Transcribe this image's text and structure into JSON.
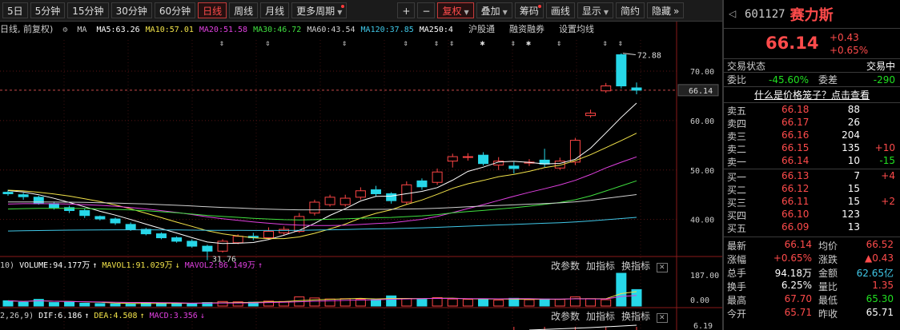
{
  "toolbar": {
    "periods": [
      {
        "label": "5日"
      },
      {
        "label": "5分钟"
      },
      {
        "label": "15分钟"
      },
      {
        "label": "30分钟"
      },
      {
        "label": "60分钟"
      },
      {
        "label": "日线",
        "active": true
      },
      {
        "label": "周线"
      },
      {
        "label": "月线"
      },
      {
        "label": "更多周期",
        "caret": true,
        "dot": true
      }
    ],
    "plus": "+",
    "minus": "−",
    "tools": [
      {
        "label": "复权",
        "active": true,
        "caret": true
      },
      {
        "label": "叠加",
        "caret": true
      },
      {
        "label": "筹码",
        "dot": true
      },
      {
        "label": "画线"
      },
      {
        "label": "显示",
        "caret": true
      },
      {
        "label": "简约"
      },
      {
        "label": "隐藏",
        "more": "»"
      }
    ]
  },
  "ma_line": {
    "prefix": "日线, 前复权)",
    "ma_label": "MA",
    "items": [
      {
        "text": "MA5:63.26",
        "color": "#ffffff"
      },
      {
        "text": "MA10:57.01",
        "color": "#f2e34a"
      },
      {
        "text": "MA20:51.58",
        "color": "#e040e0"
      },
      {
        "text": "MA30:46.72",
        "color": "#40e040"
      },
      {
        "text": "MA60:43.54",
        "color": "#cfcfcf"
      },
      {
        "text": "MA120:37.85",
        "color": "#40c8e8"
      },
      {
        "text": "MA250:4",
        "color": "#ffffff"
      }
    ],
    "links": [
      "沪股通",
      "融资融券",
      "设置均线"
    ]
  },
  "price_axis": {
    "ticks": [
      "70.00",
      "60.00",
      "50.00",
      "40.00"
    ],
    "current": "66.14"
  },
  "annotations": {
    "high": "72.88",
    "low": "31.76"
  },
  "event_markers": [
    "⇕",
    "⇕",
    "⇕",
    "⇕",
    "⇕",
    "⇕",
    "✱",
    "⇕",
    "✱",
    "⇕",
    "⇕",
    "⇕"
  ],
  "volume": {
    "prefix": "10)",
    "items": [
      {
        "text": "VOLUME:94.177万",
        "color": "#ffffff"
      },
      {
        "text": "MAVOL1:91.029万",
        "color": "#f2e34a"
      },
      {
        "text": "MAVOL2:86.149万",
        "color": "#e040e0"
      }
    ],
    "buttons": [
      "改参数",
      "加指标",
      "换指标"
    ],
    "axis": [
      "187.00",
      "0.00"
    ]
  },
  "macd": {
    "prefix": "2,26,9)",
    "items": [
      {
        "text": "DIF:6.186",
        "color": "#ffffff"
      },
      {
        "text": "DEA:4.508",
        "color": "#f2e34a"
      },
      {
        "text": "MACD:3.356",
        "color": "#e040e0"
      }
    ],
    "buttons": [
      "改参数",
      "加指标",
      "换指标"
    ],
    "axis": [
      "6.19"
    ]
  },
  "chart_data": {
    "type": "candlestick",
    "price_range": [
      33,
      75
    ],
    "candles": [
      {
        "o": 45.5,
        "c": 45.2,
        "h": 46.0,
        "l": 44.8
      },
      {
        "o": 45.0,
        "c": 44.6,
        "h": 45.4,
        "l": 44.0
      },
      {
        "o": 44.5,
        "c": 43.2,
        "h": 44.8,
        "l": 43.0
      },
      {
        "o": 43.2,
        "c": 42.4,
        "h": 43.6,
        "l": 42.0
      },
      {
        "o": 42.4,
        "c": 41.8,
        "h": 42.8,
        "l": 41.3
      },
      {
        "o": 41.8,
        "c": 40.8,
        "h": 42.2,
        "l": 40.3
      },
      {
        "o": 40.6,
        "c": 40.1,
        "h": 40.8,
        "l": 39.8
      },
      {
        "o": 40.1,
        "c": 39.3,
        "h": 40.4,
        "l": 38.9
      },
      {
        "o": 39.0,
        "c": 38.0,
        "h": 39.4,
        "l": 37.7
      },
      {
        "o": 38.0,
        "c": 37.1,
        "h": 38.3,
        "l": 36.8
      },
      {
        "o": 37.1,
        "c": 36.3,
        "h": 37.4,
        "l": 36.0
      },
      {
        "o": 36.3,
        "c": 35.6,
        "h": 36.6,
        "l": 35.3
      },
      {
        "o": 35.6,
        "c": 34.6,
        "h": 36.0,
        "l": 34.3
      },
      {
        "o": 34.6,
        "c": 33.6,
        "h": 34.9,
        "l": 31.76
      },
      {
        "o": 33.6,
        "c": 35.6,
        "h": 36.0,
        "l": 33.3
      },
      {
        "o": 35.3,
        "c": 36.6,
        "h": 37.0,
        "l": 35.0
      },
      {
        "o": 36.6,
        "c": 36.3,
        "h": 37.3,
        "l": 35.8
      },
      {
        "o": 36.3,
        "c": 37.6,
        "h": 38.4,
        "l": 35.9
      },
      {
        "o": 37.3,
        "c": 38.0,
        "h": 38.6,
        "l": 36.9
      },
      {
        "o": 37.6,
        "c": 40.6,
        "h": 41.3,
        "l": 37.3
      },
      {
        "o": 41.3,
        "c": 43.5,
        "h": 44.0,
        "l": 40.8
      },
      {
        "o": 43.0,
        "c": 44.5,
        "h": 45.0,
        "l": 42.6
      },
      {
        "o": 43.0,
        "c": 44.3,
        "h": 45.0,
        "l": 42.6
      },
      {
        "o": 44.5,
        "c": 45.8,
        "h": 46.5,
        "l": 44.0
      },
      {
        "o": 46.0,
        "c": 45.2,
        "h": 46.8,
        "l": 44.6
      },
      {
        "o": 45.2,
        "c": 43.8,
        "h": 45.5,
        "l": 43.2
      },
      {
        "o": 43.5,
        "c": 47.0,
        "h": 47.7,
        "l": 43.0
      },
      {
        "o": 47.8,
        "c": 46.6,
        "h": 48.3,
        "l": 46.0
      },
      {
        "o": 47.5,
        "c": 49.6,
        "h": 50.3,
        "l": 47.0
      },
      {
        "o": 51.8,
        "c": 52.7,
        "h": 53.3,
        "l": 50.5
      },
      {
        "o": 52.7,
        "c": 52.7,
        "h": 53.4,
        "l": 51.9
      },
      {
        "o": 53.0,
        "c": 51.3,
        "h": 53.6,
        "l": 50.9
      },
      {
        "o": 51.0,
        "c": 51.8,
        "h": 52.6,
        "l": 50.0
      },
      {
        "o": 50.8,
        "c": 50.3,
        "h": 51.6,
        "l": 49.3
      },
      {
        "o": 51.4,
        "c": 51.6,
        "h": 52.2,
        "l": 50.8
      },
      {
        "o": 52.0,
        "c": 51.2,
        "h": 54.3,
        "l": 50.6
      },
      {
        "o": 50.4,
        "c": 51.8,
        "h": 52.5,
        "l": 50.0
      },
      {
        "o": 51.6,
        "c": 56.0,
        "h": 56.5,
        "l": 51.0
      },
      {
        "o": 61.0,
        "c": 61.5,
        "h": 62.2,
        "l": 60.6
      },
      {
        "o": 66.0,
        "c": 67.0,
        "h": 67.6,
        "l": 65.6
      },
      {
        "o": 73.3,
        "c": 67.0,
        "h": 73.6,
        "l": 66.5
      },
      {
        "o": 66.6,
        "c": 66.14,
        "h": 67.7,
        "l": 65.3
      }
    ],
    "volumes": [
      30,
      22,
      38,
      20,
      22,
      16,
      14,
      12,
      11,
      20,
      18,
      16,
      14,
      20,
      26,
      24,
      22,
      28,
      26,
      52,
      46,
      40,
      42,
      38,
      36,
      58,
      42,
      38,
      48,
      40,
      38,
      40,
      34,
      44,
      36,
      40,
      38,
      52,
      42,
      36,
      187,
      94
    ]
  },
  "side": {
    "code": "601127",
    "name": "赛力斯",
    "price": "66.14",
    "change": "+0.43",
    "change_pct": "+0.65%",
    "status_label": "交易状态",
    "status_value": "交易中",
    "weibi_label": "委比",
    "weibi": "-45.60%",
    "weicha_label": "委差",
    "weicha": "-290",
    "link": "什么是价格笼子？点击查看",
    "asks": [
      {
        "label": "卖五",
        "price": "66.18",
        "vol": "88",
        "delta": ""
      },
      {
        "label": "卖四",
        "price": "66.17",
        "vol": "26",
        "delta": ""
      },
      {
        "label": "卖三",
        "price": "66.16",
        "vol": "204",
        "delta": ""
      },
      {
        "label": "卖二",
        "price": "66.15",
        "vol": "135",
        "delta": "+10",
        "dcolor": "#ff4b4b"
      },
      {
        "label": "卖一",
        "price": "66.14",
        "vol": "10",
        "delta": "-15",
        "dcolor": "#21e021"
      }
    ],
    "bids": [
      {
        "label": "买一",
        "price": "66.13",
        "vol": "7",
        "delta": "+4",
        "dcolor": "#ff4b4b"
      },
      {
        "label": "买二",
        "price": "66.12",
        "vol": "15",
        "delta": ""
      },
      {
        "label": "买三",
        "price": "66.11",
        "vol": "15",
        "delta": "+2",
        "dcolor": "#ff4b4b"
      },
      {
        "label": "买四",
        "price": "66.10",
        "vol": "123",
        "delta": ""
      },
      {
        "label": "买五",
        "price": "66.09",
        "vol": "13",
        "delta": ""
      }
    ],
    "stats": [
      {
        "l1": "最新",
        "v1": "66.14",
        "c1": "#ff4b4b",
        "l2": "均价",
        "v2": "66.52",
        "c2": "#ff4b4b"
      },
      {
        "l1": "涨幅",
        "v1": "+0.65%",
        "c1": "#ff4b4b",
        "l2": "涨跌",
        "v2": "▲0.43",
        "c2": "#ff4b4b"
      },
      {
        "l1": "总手",
        "v1": "94.18万",
        "c1": "#ffffff",
        "l2": "金额",
        "v2": "62.65亿",
        "c2": "#40c8e8"
      },
      {
        "l1": "换手",
        "v1": "6.25%",
        "c1": "#ffffff",
        "l2": "量比",
        "v2": "1.35",
        "c2": "#ff4b4b"
      },
      {
        "l1": "最高",
        "v1": "67.70",
        "c1": "#ff4b4b",
        "l2": "最低",
        "v2": "65.30",
        "c2": "#21e021"
      },
      {
        "l1": "今开",
        "v1": "65.71",
        "c1": "#ff4b4b",
        "l2": "昨收",
        "v2": "65.71",
        "c2": "#ffffff"
      }
    ]
  }
}
